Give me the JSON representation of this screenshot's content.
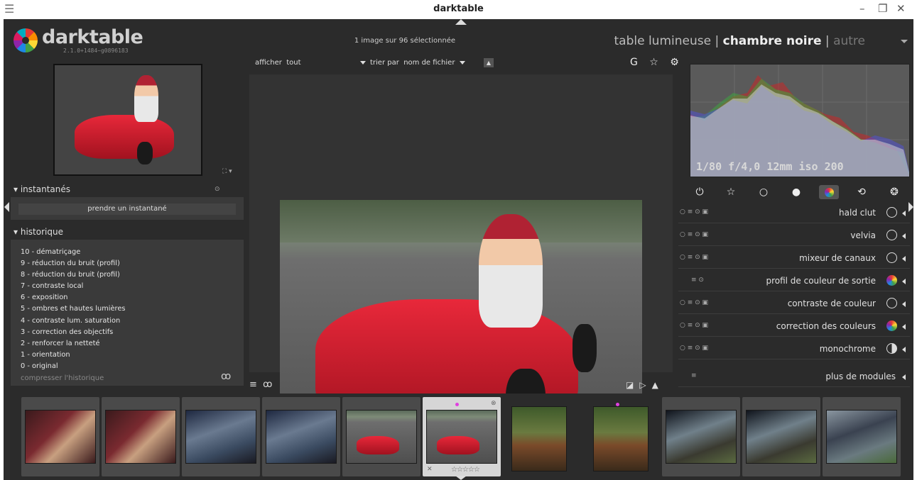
{
  "window": {
    "title": "darktable"
  },
  "header": {
    "logo_text": "darktable",
    "version": "2.1.0+1484~g0896183",
    "selection_info": "1 image sur 96 sélectionnée",
    "views": {
      "lighttable": "table lumineuse",
      "sep": "|",
      "darkroom": "chambre noire",
      "other": "autre"
    }
  },
  "left": {
    "snapshots": {
      "title": "instantanés",
      "button": "prendre un instantané"
    },
    "history": {
      "title": "historique",
      "items": [
        "10 - dématriçage",
        "9 - réduction du bruit (profil)",
        "8 - réduction du bruit (profil)",
        "7 - contraste local",
        "6 - exposition",
        "5 - ombres et hautes lumières",
        "4 - contraste lum. saturation",
        "3 - correction des objectifs",
        "2 - renforcer la netteté",
        "1 - orientation",
        "0 - original"
      ],
      "compress": "compresser l'historique"
    }
  },
  "center": {
    "show_label": "afficher",
    "show_value": "tout",
    "sort_label": "trier par",
    "sort_value": "nom de fichier",
    "top_icons": "G ☆ ⚙"
  },
  "right": {
    "exif": "1/80 f/4,0 12mm iso 200",
    "modules": [
      {
        "name": "hald clut"
      },
      {
        "name": "velvia"
      },
      {
        "name": "mixeur de canaux"
      },
      {
        "name": "profil de couleur de sortie"
      },
      {
        "name": "contraste de couleur"
      },
      {
        "name": "correction des couleurs"
      },
      {
        "name": "monochrome"
      },
      {
        "name": "plus de modules"
      }
    ]
  },
  "filmstrip": {
    "stars": "☆☆☆☆☆"
  }
}
